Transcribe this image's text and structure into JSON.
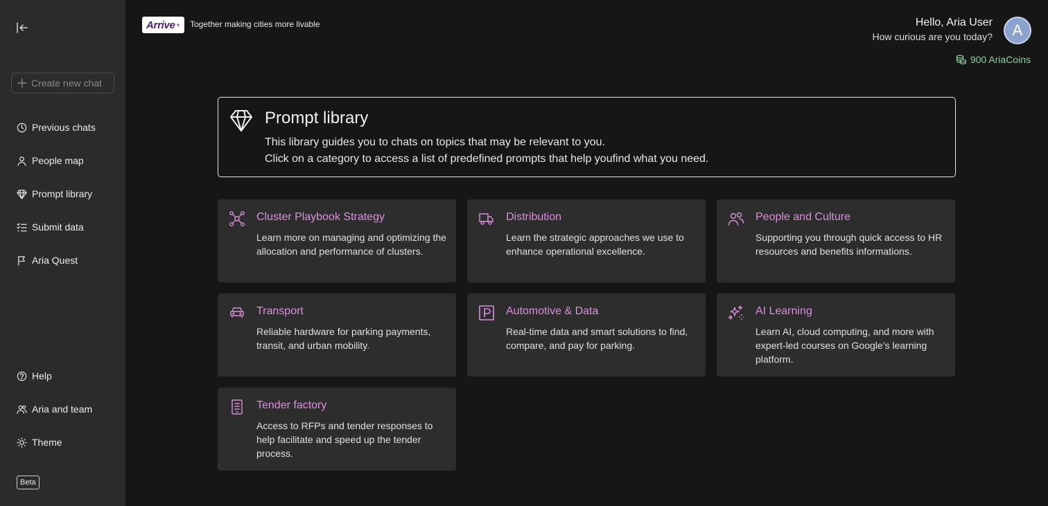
{
  "sidebar": {
    "collapse_icon": "collapse-left-icon",
    "new_chat_label": "Create new chat",
    "items": [
      {
        "label": "Previous chats",
        "icon": "clock-icon"
      },
      {
        "label": "People map",
        "icon": "person-icon"
      },
      {
        "label": "Prompt library",
        "icon": "diamond-icon"
      },
      {
        "label": "Submit data",
        "icon": "checklist-icon"
      },
      {
        "label": "Aria Quest",
        "icon": "flag-icon"
      }
    ],
    "bottom_items": [
      {
        "label": "Help",
        "icon": "help-circle-icon"
      },
      {
        "label": "Aria and team",
        "icon": "team-icon"
      },
      {
        "label": "Theme",
        "icon": "sun-icon"
      }
    ],
    "beta_label": "Beta"
  },
  "header": {
    "logo_text": "Arrive",
    "tagline": "Together making cities more livable",
    "greeting": "Hello, Aria User",
    "subgreeting": "How curious are you today?",
    "avatar_letter": "A",
    "coins": "900 AriaCoins"
  },
  "hero": {
    "title": "Prompt library",
    "desc1": "This library guides you to chats on topics that may be relevant to you.",
    "desc2": "Click on a category to access a list of predefined prompts that help youfind what you need."
  },
  "cards": [
    {
      "title": "Cluster Playbook Strategy",
      "desc": "Learn more on managing and optimizing the allocation and performance of clusters.",
      "icon": "cluster-icon"
    },
    {
      "title": "Distribution",
      "desc": "Learn the strategic approaches we use to enhance operational excellence.",
      "icon": "truck-icon"
    },
    {
      "title": "People and Culture",
      "desc": "Supporting you through quick access to HR resources and benefits informations.",
      "icon": "people-icon"
    },
    {
      "title": "Transport",
      "desc": "Reliable hardware for parking payments, transit, and urban mobility.",
      "icon": "car-icon"
    },
    {
      "title": "Automotive & Data",
      "desc": "Real-time data and smart solutions to find, compare, and pay for parking.",
      "icon": "parking-icon"
    },
    {
      "title": "AI Learning",
      "desc": "Learn AI, cloud computing, and more with expert-led courses on Google’s learning platform.",
      "icon": "sparkles-icon"
    },
    {
      "title": "Tender factory",
      "desc": "Access to RFPs and tender responses to help facilitate and speed up the tender process.",
      "icon": "document-icon"
    }
  ],
  "colors": {
    "accent": "#dc8fde",
    "coins": "#8dcfa1",
    "sidebar_bg": "#2b2b2b",
    "page_bg": "#161616",
    "card_bg": "#2d2d2d"
  }
}
